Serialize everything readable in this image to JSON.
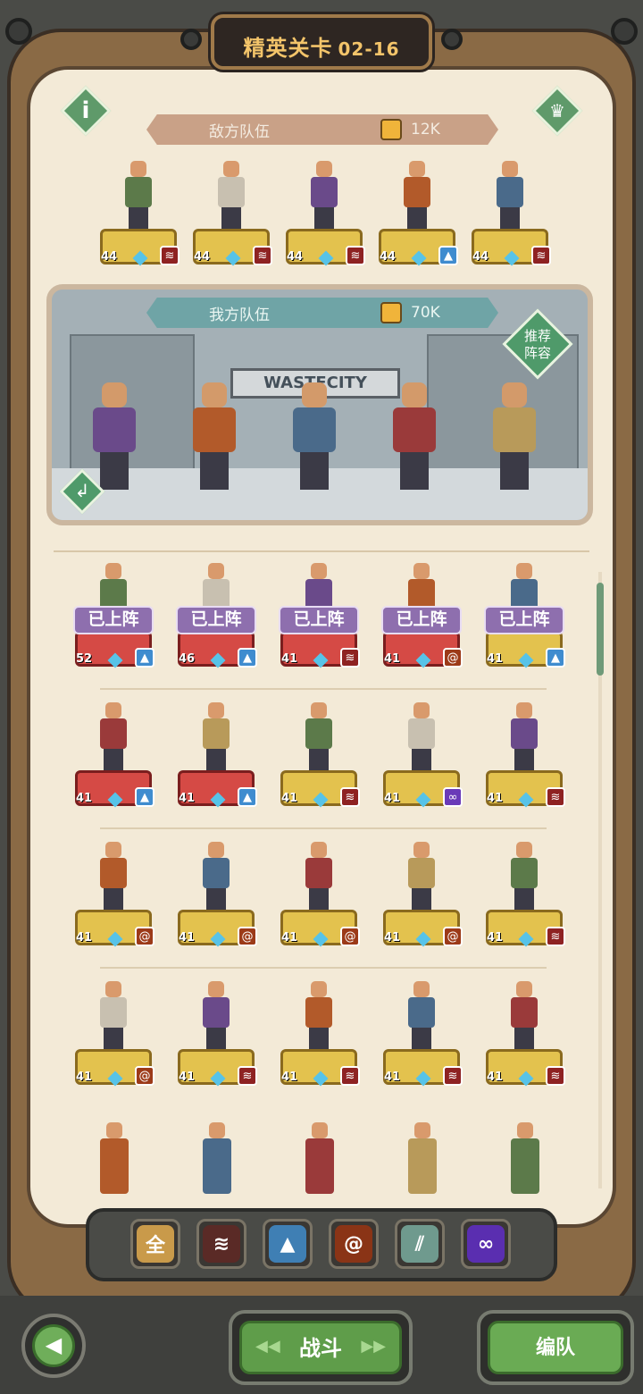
{
  "header": {
    "title": "精英关卡",
    "stage": "02-16"
  },
  "enemy": {
    "label": "敌方队伍",
    "power": "12K",
    "units": [
      {
        "level": "44",
        "faction": "red"
      },
      {
        "level": "44",
        "faction": "red"
      },
      {
        "level": "44",
        "faction": "red"
      },
      {
        "level": "44",
        "faction": "blue"
      },
      {
        "level": "44",
        "faction": "red"
      }
    ]
  },
  "ally": {
    "label": "我方队伍",
    "power": "70K",
    "sign": "WASTECITY",
    "recommend_label_1": "推荐",
    "recommend_label_2": "阵容"
  },
  "roster": {
    "deployed_label": "已上阵",
    "rows": [
      [
        {
          "level": "52",
          "faction": "blue",
          "deployed": true
        },
        {
          "level": "46",
          "faction": "blue",
          "deployed": true
        },
        {
          "level": "41",
          "faction": "red",
          "deployed": true
        },
        {
          "level": "41",
          "faction": "orange",
          "deployed": true
        },
        {
          "level": "41",
          "faction": "blue",
          "deployed": true
        }
      ],
      [
        {
          "level": "41",
          "faction": "blue",
          "deployed": false
        },
        {
          "level": "41",
          "faction": "blue",
          "deployed": false
        },
        {
          "level": "41",
          "faction": "red",
          "deployed": false
        },
        {
          "level": "41",
          "faction": "purple",
          "deployed": false
        },
        {
          "level": "41",
          "faction": "red",
          "deployed": false
        }
      ],
      [
        {
          "level": "41",
          "faction": "orange",
          "deployed": false
        },
        {
          "level": "41",
          "faction": "orange",
          "deployed": false
        },
        {
          "level": "41",
          "faction": "orange",
          "deployed": false
        },
        {
          "level": "41",
          "faction": "orange",
          "deployed": false
        },
        {
          "level": "41",
          "faction": "red",
          "deployed": false
        }
      ],
      [
        {
          "level": "41",
          "faction": "orange",
          "deployed": false
        },
        {
          "level": "41",
          "faction": "red",
          "deployed": false
        },
        {
          "level": "41",
          "faction": "red",
          "deployed": false
        },
        {
          "level": "41",
          "faction": "red",
          "deployed": false
        },
        {
          "level": "41",
          "faction": "red",
          "deployed": false
        }
      ]
    ]
  },
  "filters": {
    "all": "全"
  },
  "buttons": {
    "fight": "战斗",
    "team": "编队",
    "back": "◀"
  },
  "colors": {
    "accent_green": "#5f9d4a",
    "title_gold": "#f3c46a",
    "deployed_purple": "#8e6fae"
  }
}
